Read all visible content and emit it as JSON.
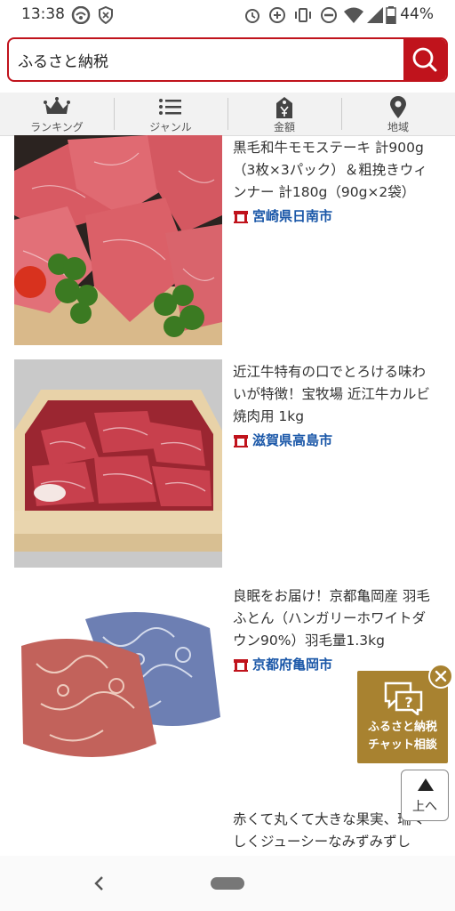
{
  "status": {
    "time": "13:38",
    "battery": "44%"
  },
  "search": {
    "query": "ふるさと納税"
  },
  "categories": [
    {
      "label": "ランキング",
      "icon": "crown-icon"
    },
    {
      "label": "ジャンル",
      "icon": "list-icon"
    },
    {
      "label": "金額",
      "icon": "yen-tag-icon"
    },
    {
      "label": "地域",
      "icon": "map-pin-icon"
    }
  ],
  "items": [
    {
      "title": "黒毛和牛モモステーキ 計900g（3枚×3パック）＆粗挽きウィンナー 計180g（90g×2袋）",
      "location": "宮崎県日南市"
    },
    {
      "title": "近江牛特有の口でとろける味わいが特徴！宝牧場 近江牛カルビ焼肉用 1kg",
      "location": "滋賀県高島市"
    },
    {
      "title": "良眠をお届け！京都亀岡産 羽毛ふとん（ハンガリーホワイトダウン90%）羽毛量1.3kg",
      "location": "京都府亀岡市"
    },
    {
      "title": "赤くて丸くて大きな果実、瑞々しくジューシーなみずみずし",
      "location": ""
    }
  ],
  "chat": {
    "line1": "ふるさと納税",
    "line2": "チャット相談"
  },
  "to_top": {
    "label": "上へ"
  },
  "colors": {
    "brand_red": "#c0131c",
    "location_blue": "#1a57a8",
    "chat_gold": "#a88230"
  }
}
